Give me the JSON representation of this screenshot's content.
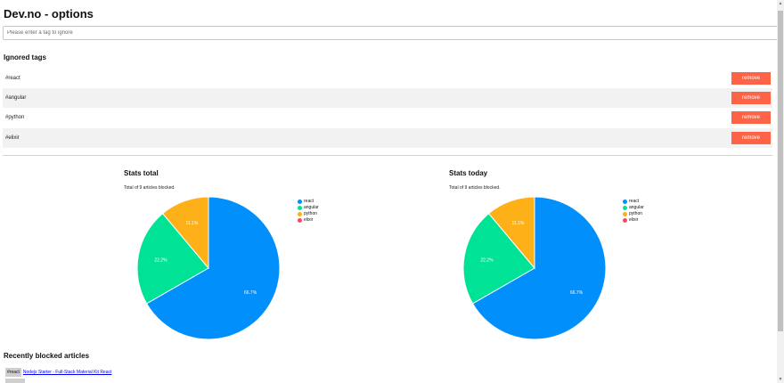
{
  "header": {
    "title": "Dev.no - options"
  },
  "tag_input": {
    "placeholder": "Please enter a tag to ignore"
  },
  "ignored": {
    "title": "Ignored tags",
    "remove_label": "remove",
    "tags": [
      "#react",
      "#angular",
      "#python",
      "#elixir"
    ]
  },
  "stats_total": {
    "title": "Stats total",
    "subtitle": "Total of 9 articles blocked.",
    "legend": [
      {
        "label": "react",
        "color": "#008ffb"
      },
      {
        "label": "angular",
        "color": "#00e396"
      },
      {
        "label": "python",
        "color": "#feb019"
      },
      {
        "label": "elixir",
        "color": "#ff4560"
      }
    ]
  },
  "stats_today": {
    "title": "Stats today",
    "subtitle": "Total of 9 articles blocked.",
    "legend": [
      {
        "label": "react",
        "color": "#008ffb"
      },
      {
        "label": "angular",
        "color": "#00e396"
      },
      {
        "label": "python",
        "color": "#feb019"
      },
      {
        "label": "elixir",
        "color": "#ff4560"
      }
    ]
  },
  "chart_data": [
    {
      "type": "pie",
      "title": "Stats total",
      "categories": [
        "react",
        "angular",
        "python",
        "elixir"
      ],
      "values": [
        66.7,
        22.2,
        11.1,
        0
      ],
      "labels": [
        "66.7%",
        "22.2%",
        "11.1%",
        ""
      ],
      "colors": [
        "#008ffb",
        "#00e396",
        "#feb019",
        "#ff4560"
      ],
      "legend": "right"
    },
    {
      "type": "pie",
      "title": "Stats today",
      "categories": [
        "react",
        "angular",
        "python",
        "elixir"
      ],
      "values": [
        66.7,
        22.2,
        11.1,
        0
      ],
      "labels": [
        "66.7%",
        "22.2%",
        "11.1%",
        ""
      ],
      "colors": [
        "#008ffb",
        "#00e396",
        "#feb019",
        "#ff4560"
      ],
      "legend": "right"
    }
  ],
  "recent": {
    "title": "Recently blocked articles",
    "items": [
      {
        "tag": "#react",
        "title": "Nodejs Starter - Full-Stack Material Kit React"
      }
    ]
  }
}
